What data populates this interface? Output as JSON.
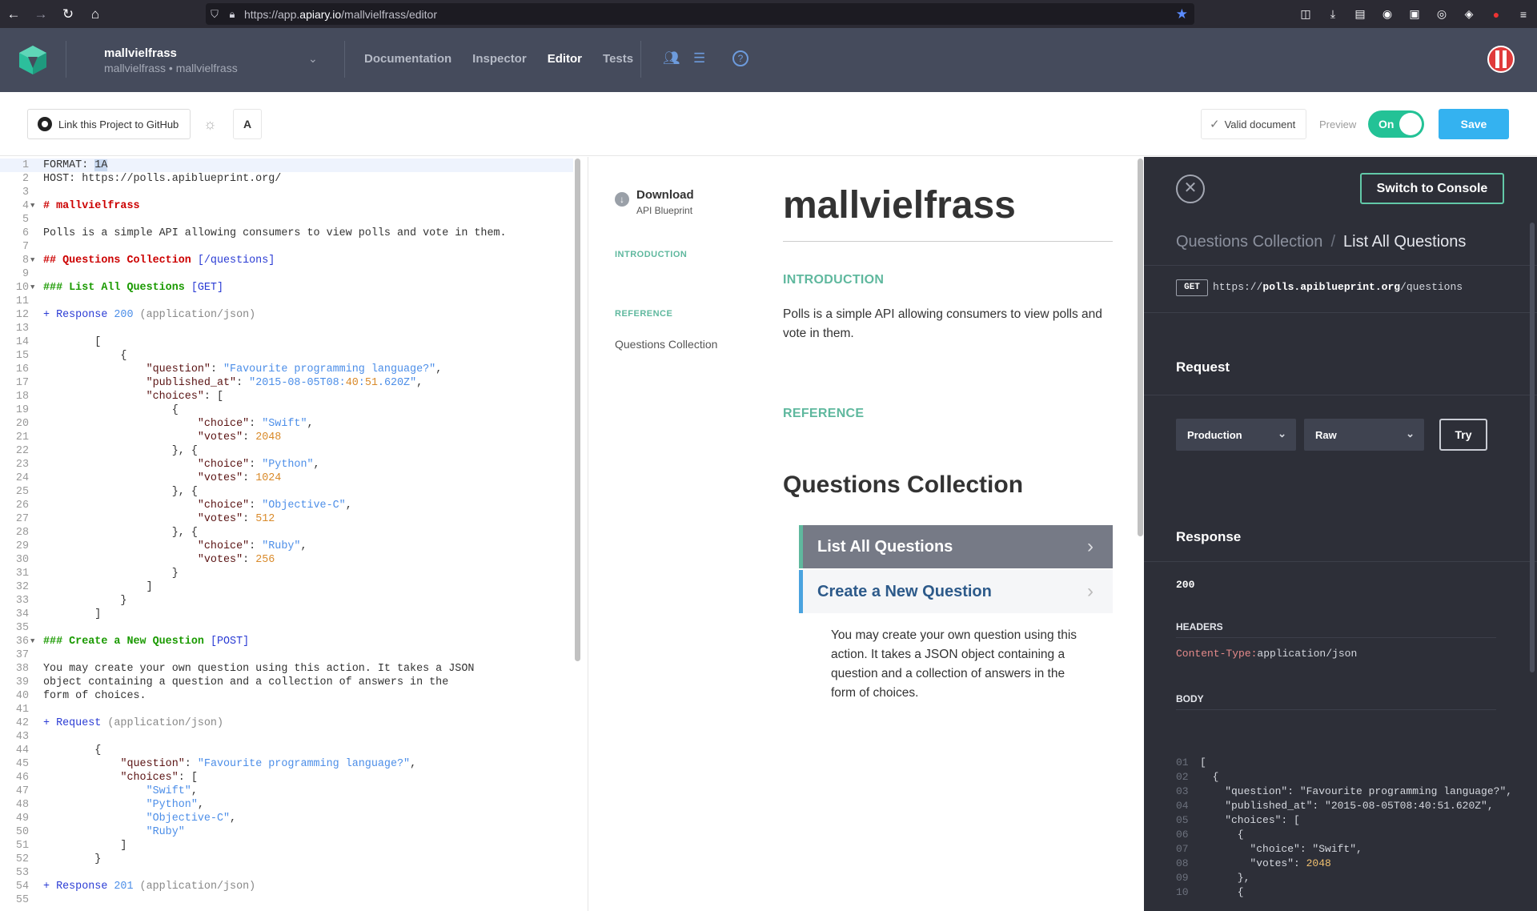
{
  "browser": {
    "url_prefix": "https://app.",
    "url_domain": "apiary.io",
    "url_path": "/mallvielfrass/editor"
  },
  "header": {
    "project_name": "mallvielfrass",
    "project_sub": "mallvielfrass • mallvielfrass",
    "nav": [
      "Documentation",
      "Inspector",
      "Editor",
      "Tests"
    ],
    "active_nav": "Editor"
  },
  "toolbar": {
    "github_label": "Link this Project to GitHub",
    "font_label": "A",
    "valid_label": "Valid document",
    "preview_label": "Preview",
    "toggle_label": "On",
    "save_label": "Save"
  },
  "editor": {
    "lines": [
      {
        "n": "1",
        "t": "FORMAT: 1A"
      },
      {
        "n": "2",
        "t": "HOST: https://polls.apiblueprint.org/"
      },
      {
        "n": "3",
        "t": ""
      },
      {
        "n": "4",
        "t": "# mallvielfrass",
        "fold": true
      },
      {
        "n": "5",
        "t": ""
      },
      {
        "n": "6",
        "t": "Polls is a simple API allowing consumers to view polls and vote in them."
      },
      {
        "n": "7",
        "t": ""
      },
      {
        "n": "8",
        "t": "## Questions Collection [/questions]",
        "fold": true
      },
      {
        "n": "9",
        "t": ""
      },
      {
        "n": "10",
        "t": "### List All Questions [GET]",
        "fold": true
      },
      {
        "n": "11",
        "t": ""
      },
      {
        "n": "12",
        "t": "+ Response 200 (application/json)"
      },
      {
        "n": "13",
        "t": ""
      },
      {
        "n": "14",
        "t": "        ["
      },
      {
        "n": "15",
        "t": "            {"
      },
      {
        "n": "16",
        "t": "                \"question\": \"Favourite programming language?\","
      },
      {
        "n": "17",
        "t": "                \"published_at\": \"2015-08-05T08:40:51.620Z\","
      },
      {
        "n": "18",
        "t": "                \"choices\": ["
      },
      {
        "n": "19",
        "t": "                    {"
      },
      {
        "n": "20",
        "t": "                        \"choice\": \"Swift\","
      },
      {
        "n": "21",
        "t": "                        \"votes\": 2048"
      },
      {
        "n": "22",
        "t": "                    }, {"
      },
      {
        "n": "23",
        "t": "                        \"choice\": \"Python\","
      },
      {
        "n": "24",
        "t": "                        \"votes\": 1024"
      },
      {
        "n": "25",
        "t": "                    }, {"
      },
      {
        "n": "26",
        "t": "                        \"choice\": \"Objective-C\","
      },
      {
        "n": "27",
        "t": "                        \"votes\": 512"
      },
      {
        "n": "28",
        "t": "                    }, {"
      },
      {
        "n": "29",
        "t": "                        \"choice\": \"Ruby\","
      },
      {
        "n": "30",
        "t": "                        \"votes\": 256"
      },
      {
        "n": "31",
        "t": "                    }"
      },
      {
        "n": "32",
        "t": "                ]"
      },
      {
        "n": "33",
        "t": "            }"
      },
      {
        "n": "34",
        "t": "        ]"
      },
      {
        "n": "35",
        "t": ""
      },
      {
        "n": "36",
        "t": "### Create a New Question [POST]",
        "fold": true
      },
      {
        "n": "37",
        "t": ""
      },
      {
        "n": "38",
        "t": "You may create your own question using this action. It takes a JSON"
      },
      {
        "n": "39",
        "t": "object containing a question and a collection of answers in the"
      },
      {
        "n": "40",
        "t": "form of choices."
      },
      {
        "n": "41",
        "t": ""
      },
      {
        "n": "42",
        "t": "+ Request (application/json)"
      },
      {
        "n": "43",
        "t": ""
      },
      {
        "n": "44",
        "t": "        {"
      },
      {
        "n": "45",
        "t": "            \"question\": \"Favourite programming language?\","
      },
      {
        "n": "46",
        "t": "            \"choices\": ["
      },
      {
        "n": "47",
        "t": "                \"Swift\","
      },
      {
        "n": "48",
        "t": "                \"Python\","
      },
      {
        "n": "49",
        "t": "                \"Objective-C\","
      },
      {
        "n": "50",
        "t": "                \"Ruby\""
      },
      {
        "n": "51",
        "t": "            ]"
      },
      {
        "n": "52",
        "t": "        }"
      },
      {
        "n": "53",
        "t": ""
      },
      {
        "n": "54",
        "t": "+ Response 201 (application/json)"
      },
      {
        "n": "55",
        "t": ""
      }
    ]
  },
  "preview": {
    "download_title": "Download",
    "download_sub": "API Blueprint",
    "toc_intro": "INTRODUCTION",
    "toc_reference": "REFERENCE",
    "toc_link": "Questions Collection",
    "title": "mallvielfrass",
    "intro_heading": "INTRODUCTION",
    "intro_text": "Polls is a simple API allowing consumers to view polls and vote in them.",
    "reference_heading": "REFERENCE",
    "collection_title": "Questions Collection",
    "action_active": "List All Questions",
    "action_idle": "Create a New Question",
    "action_desc": "You may create your own question using this action. It takes a JSON object containing a question and a collection of answers in the form of choices."
  },
  "console": {
    "switch_label": "Switch to Console",
    "breadcrumb_a": "Questions Collection",
    "breadcrumb_b": "List All Questions",
    "method": "GET",
    "url_prefix": "https://",
    "url_host": "polls.apiblueprint.org",
    "url_path": "/questions",
    "request_heading": "Request",
    "env_select": "Production",
    "format_select": "Raw",
    "try_label": "Try",
    "response_heading": "Response",
    "status": "200",
    "headers_heading": "HEADERS",
    "header_key": "Content-Type:",
    "header_value": "application/json",
    "body_heading": "BODY",
    "body_lines": [
      {
        "n": "01",
        "t": "["
      },
      {
        "n": "02",
        "t": "  {"
      },
      {
        "n": "03",
        "t": "    \"question\": \"Favourite programming language?\","
      },
      {
        "n": "04",
        "t": "    \"published_at\": \"2015-08-05T08:40:51.620Z\","
      },
      {
        "n": "05",
        "t": "    \"choices\": ["
      },
      {
        "n": "06",
        "t": "      {"
      },
      {
        "n": "07",
        "t": "        \"choice\": \"Swift\","
      },
      {
        "n": "08",
        "t": "        \"votes\": 2048"
      },
      {
        "n": "09",
        "t": "      },"
      },
      {
        "n": "10",
        "t": "      {"
      }
    ]
  }
}
